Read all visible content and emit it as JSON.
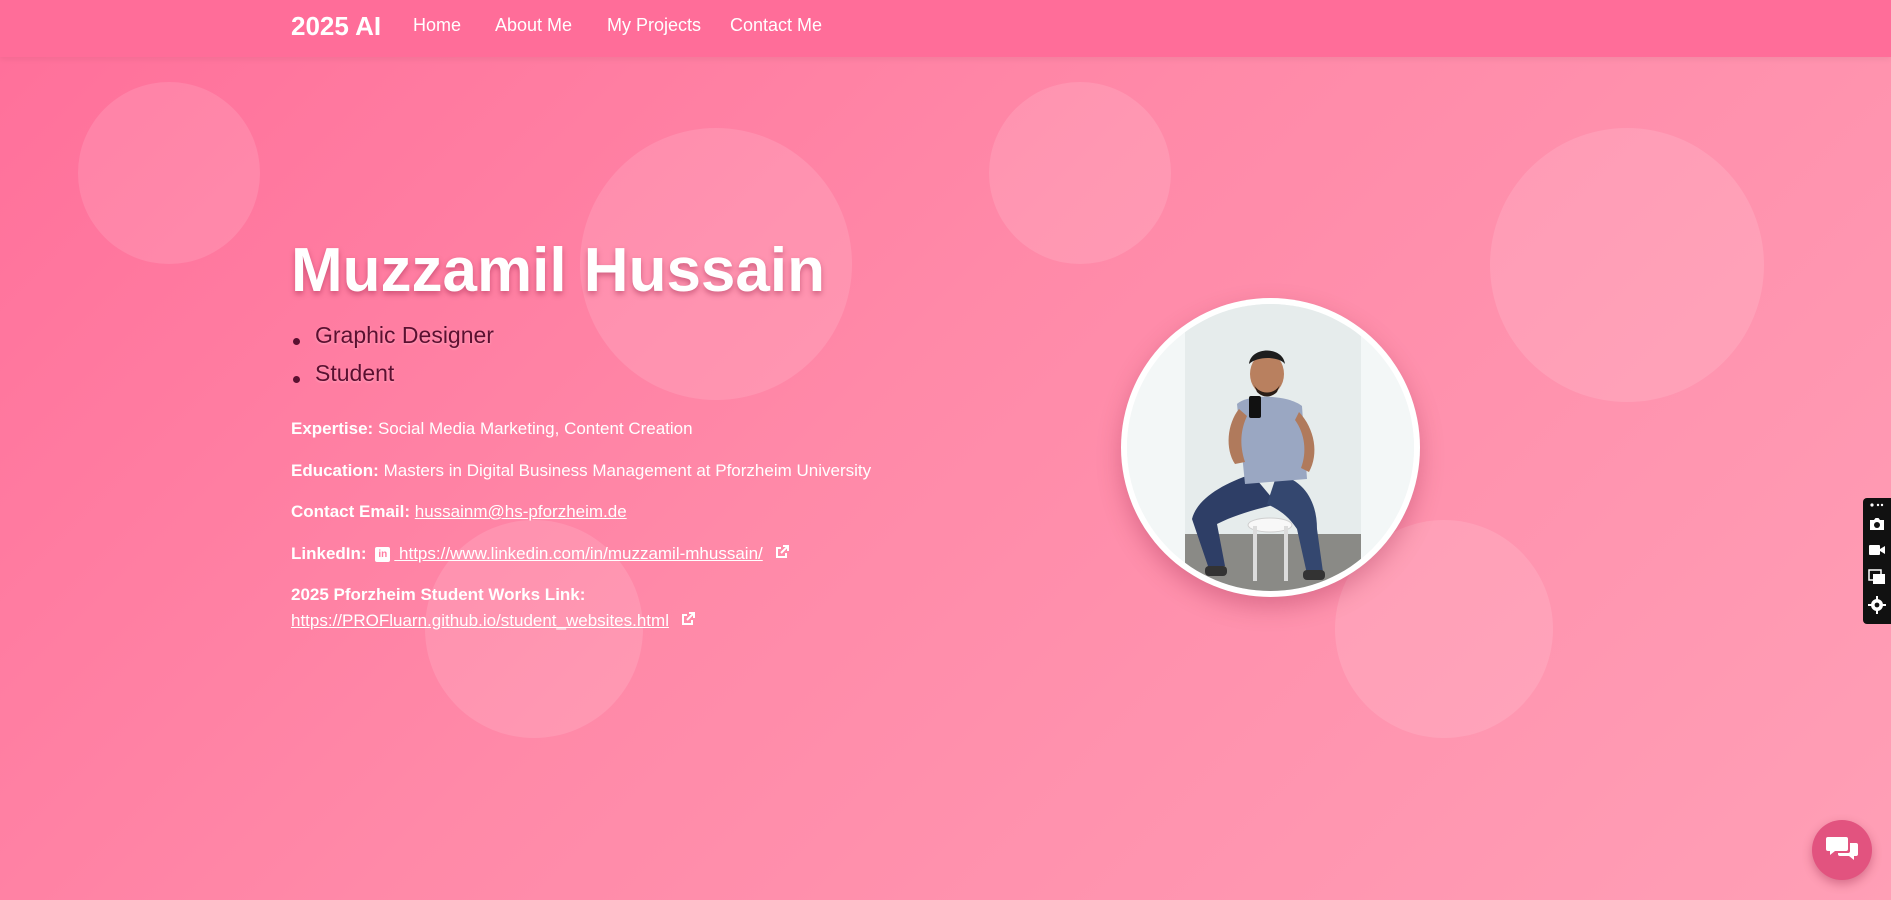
{
  "nav": {
    "brand": "2025 AI",
    "links": [
      "Home",
      "About Me",
      "My Projects",
      "Contact Me"
    ]
  },
  "hero": {
    "name": "Muzzamil Hussain",
    "roles": [
      "Graphic Designer",
      "Student"
    ]
  },
  "details": {
    "expertise_label": "Expertise:",
    "expertise_value": "Social Media Marketing, Content Creation",
    "education_label": "Education:",
    "education_value": "Masters in Digital Business Management at Pforzheim University",
    "email_label": "Contact Email:",
    "email_value": "hussainm@hs-pforzheim.de",
    "linkedin_label": "LinkedIn:",
    "linkedin_icon_text": "in",
    "linkedin_value": " https://www.linkedin.com/in/muzzamil-mhussain/",
    "works_label": "2025 Pforzheim Student Works Link:",
    "works_value": "https://PROFluarn.github.io/student_websites.html"
  },
  "icons": {
    "external_link": "external-link-icon",
    "linkedin": "linkedin-icon",
    "chat": "chat-icon",
    "camera": "camera-icon",
    "video": "video-icon",
    "window": "window-icon",
    "gear": "gear-icon"
  },
  "colors": {
    "navbar": "#ff6d99",
    "background_start": "#ff6f9a",
    "background_end": "#ff9fb6",
    "role_text": "#5a1030",
    "chat_button": "#e2537f"
  }
}
